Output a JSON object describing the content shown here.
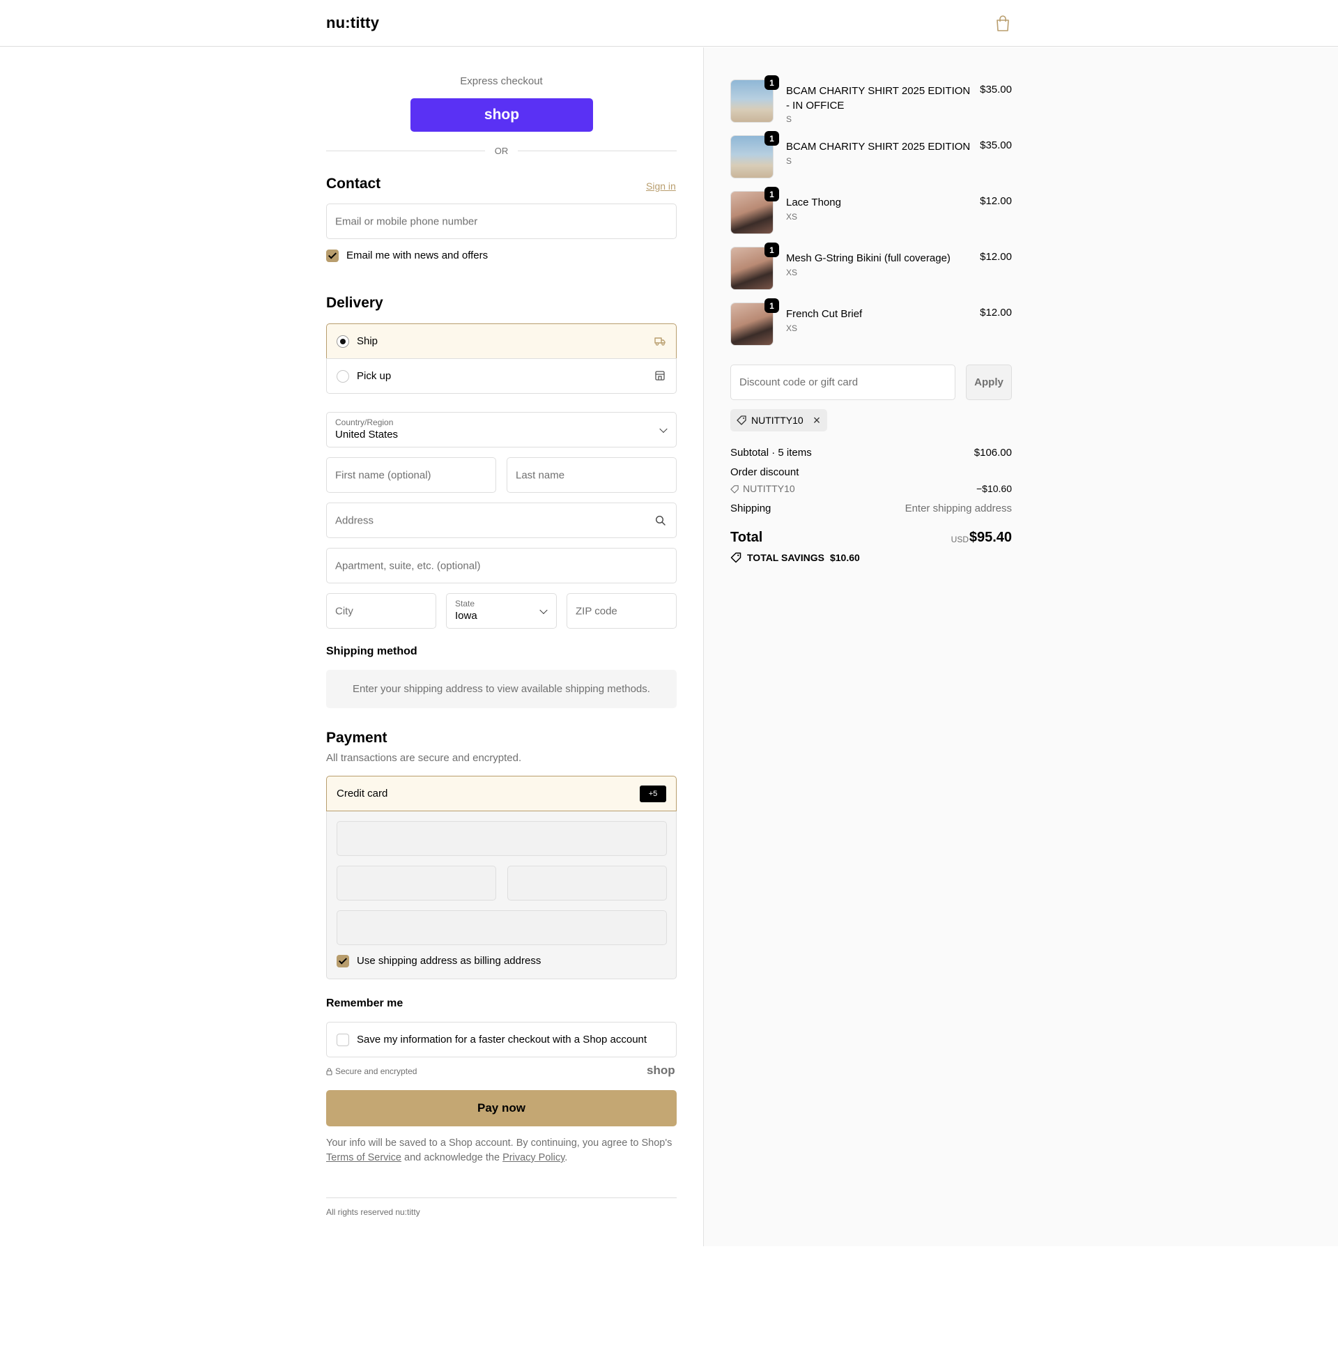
{
  "header": {
    "brand": "nu:titty",
    "cart_icon": "shopping-bag-icon"
  },
  "express": {
    "title": "Express checkout",
    "shop_pay_label": "shop",
    "or_label": "OR"
  },
  "contact": {
    "heading": "Contact",
    "sign_in": "Sign in",
    "email_placeholder": "Email or mobile phone number",
    "newsletter_label": "Email me with news and offers",
    "newsletter_checked": true
  },
  "delivery": {
    "heading": "Delivery",
    "options": [
      {
        "label": "Ship",
        "selected": true,
        "icon": "truck-icon"
      },
      {
        "label": "Pick up",
        "selected": false,
        "icon": "store-icon"
      }
    ],
    "country_label": "Country/Region",
    "country_value": "United States",
    "first_name_placeholder": "First name (optional)",
    "last_name_placeholder": "Last name",
    "address_placeholder": "Address",
    "apartment_placeholder": "Apartment, suite, etc. (optional)",
    "city_placeholder": "City",
    "state_label": "State",
    "state_value": "Iowa",
    "zip_placeholder": "ZIP code"
  },
  "shipping_method": {
    "heading": "Shipping method",
    "note": "Enter your shipping address to view available shipping methods."
  },
  "payment": {
    "heading": "Payment",
    "subtitle": "All transactions are secure and encrypted.",
    "method_label": "Credit card",
    "more_badge": "+5",
    "billing_same_label": "Use shipping address as billing address",
    "billing_same_checked": true
  },
  "remember": {
    "heading": "Remember me",
    "save_label": "Save my information for a faster checkout with a Shop account",
    "save_checked": false,
    "secure_text": "Secure and encrypted",
    "shop_logo": "shop"
  },
  "pay_button": "Pay now",
  "legal": {
    "prefix": "Your info will be saved to a Shop account. By continuing, you agree to Shop's",
    "terms": "Terms of Service",
    "middle": " and acknowledge the ",
    "privacy": "Privacy Policy",
    "suffix": "."
  },
  "footer": "All rights reserved nu:titty",
  "order": {
    "items": [
      {
        "name": "BCAM CHARITY SHIRT 2025 EDITION - IN OFFICE",
        "variant": "S",
        "price": "$35.00",
        "qty": "1"
      },
      {
        "name": "BCAM CHARITY SHIRT 2025 EDITION",
        "variant": "S",
        "price": "$35.00",
        "qty": "1"
      },
      {
        "name": "Lace Thong",
        "variant": "XS",
        "price": "$12.00",
        "qty": "1"
      },
      {
        "name": "Mesh G-String Bikini (full coverage)",
        "variant": "XS",
        "price": "$12.00",
        "qty": "1"
      },
      {
        "name": "French Cut Brief",
        "variant": "XS",
        "price": "$12.00",
        "qty": "1"
      }
    ],
    "discount_placeholder": "Discount code or gift card",
    "apply_label": "Apply",
    "applied_code": "NUTITTY10",
    "subtotal_label": "Subtotal · 5 items",
    "subtotal_value": "$106.00",
    "order_discount_label": "Order discount",
    "discount_code": "NUTITTY10",
    "discount_value": "−$10.60",
    "shipping_label": "Shipping",
    "shipping_value": "Enter shipping address",
    "total_label": "Total",
    "currency": "USD",
    "total_value": "$95.40",
    "savings_label": "TOTAL SAVINGS",
    "savings_value": "$10.60"
  },
  "colors": {
    "accent": "#c4a773",
    "accent_dark": "#b89d6d",
    "shop_purple": "#5a31f4",
    "selected_bg": "#fdf8ec"
  }
}
